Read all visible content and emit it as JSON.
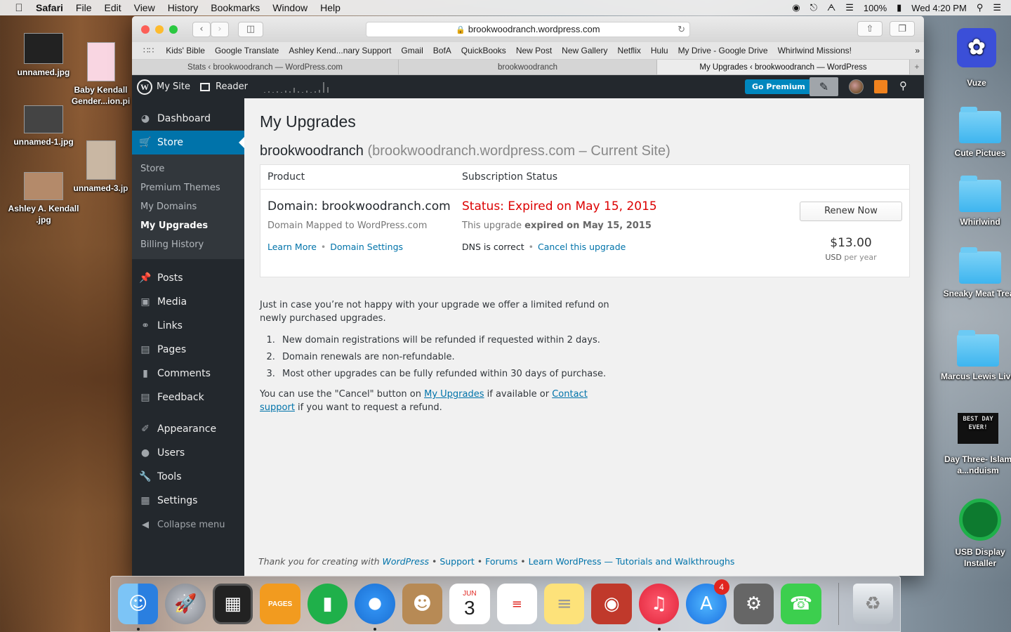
{
  "menubar": {
    "app": "Safari",
    "menus": [
      "File",
      "Edit",
      "View",
      "History",
      "Bookmarks",
      "Window",
      "Help"
    ],
    "battery": "100%",
    "clock": "Wed 4:20 PM"
  },
  "desktop": {
    "left_icons": [
      "unnamed.jpg",
      "Baby Kendall Gender...ion.pi",
      "unnamed-1.jpg",
      "unnamed-3.jp",
      "Ashley A. Kendall .jpg"
    ],
    "right_icons": [
      "Vuze",
      "Cute Pictues",
      "Whirlwind",
      "Sneaky Meat Treat",
      "Marcus Lewis Live",
      "Day Three- Islam a...nduism",
      "USB Display Installer"
    ],
    "best_day_text": "BEST DAY EVER!"
  },
  "browser": {
    "url": "brookwoodranch.wordpress.com",
    "bookmarks": [
      "Kids' Bible",
      "Google Translate",
      "Ashley Kend...nary Support",
      "Gmail",
      "BofA",
      "QuickBooks",
      "New Post",
      "New Gallery",
      "Netflix",
      "Hulu",
      "My Drive - Google Drive",
      "Whirlwind Missions!"
    ],
    "tabs": [
      "Stats ‹ brookwoodranch — WordPress.com",
      "brookwoodranch",
      "My Upgrades ‹ brookwoodranch — WordPress"
    ]
  },
  "adminbar": {
    "my_site": "My Site",
    "reader": "Reader",
    "go_premium": "Go Premium"
  },
  "sidebar": {
    "top": [
      {
        "label": "Dashboard",
        "icon": "dashboard-icon"
      },
      {
        "label": "Store",
        "icon": "cart-icon"
      }
    ],
    "store_sub": [
      "Store",
      "Premium Themes",
      "My Domains",
      "My Upgrades",
      "Billing History"
    ],
    "content": [
      {
        "label": "Posts",
        "icon": "pin-icon"
      },
      {
        "label": "Media",
        "icon": "media-icon"
      },
      {
        "label": "Links",
        "icon": "link-icon"
      },
      {
        "label": "Pages",
        "icon": "pages-icon"
      },
      {
        "label": "Comments",
        "icon": "comment-icon"
      },
      {
        "label": "Feedback",
        "icon": "feedback-icon"
      }
    ],
    "admin": [
      {
        "label": "Appearance",
        "icon": "brush-icon"
      },
      {
        "label": "Users",
        "icon": "user-icon"
      },
      {
        "label": "Tools",
        "icon": "wrench-icon"
      },
      {
        "label": "Settings",
        "icon": "settings-icon"
      }
    ],
    "collapse": "Collapse menu"
  },
  "page": {
    "title": "My Upgrades",
    "site_name": "brookwoodranch",
    "site_detail": "(brookwoodranch.wordpress.com – Current Site)",
    "table": {
      "col_product": "Product",
      "col_status": "Subscription Status",
      "domain_title": "Domain: brookwoodranch.com",
      "domain_sub": "Domain Mapped to WordPress.com",
      "learn_more": "Learn More",
      "domain_settings": "Domain Settings",
      "status": "Status: Expired on May 15, 2015",
      "status_sub_prefix": "This upgrade",
      "status_sub_bold": "expired on May 15, 2015",
      "dns": "DNS is correct",
      "cancel": "Cancel this upgrade",
      "renew": "Renew Now",
      "price": "$13.00",
      "currency": "USD",
      "period": "per year"
    },
    "refund": {
      "intro": "Just in case you’re not happy with your upgrade we offer a limited refund on newly purchased upgrades.",
      "items": [
        "New domain registrations will be refunded if requested within 2 days.",
        "Domain renewals are non-refundable.",
        "Most other upgrades can be fully refunded within 30 days of purchase."
      ],
      "outro_1": "You can use the \"Cancel\" button on ",
      "link_upgrades": "My Upgrades",
      "outro_2": " if available or ",
      "link_support": "Contact support",
      "outro_3": " if you want to request a refund."
    },
    "footer": {
      "thanks": "Thank you for creating with ",
      "wordpress": "WordPress",
      "support": "Support",
      "forums": "Forums",
      "learn": "Learn WordPress — Tutorials and Walkthroughs"
    }
  },
  "dock": {
    "calendar_month": "JUN",
    "calendar_day": "3",
    "appstore_badge": "4",
    "pages_label": "PAGES"
  }
}
